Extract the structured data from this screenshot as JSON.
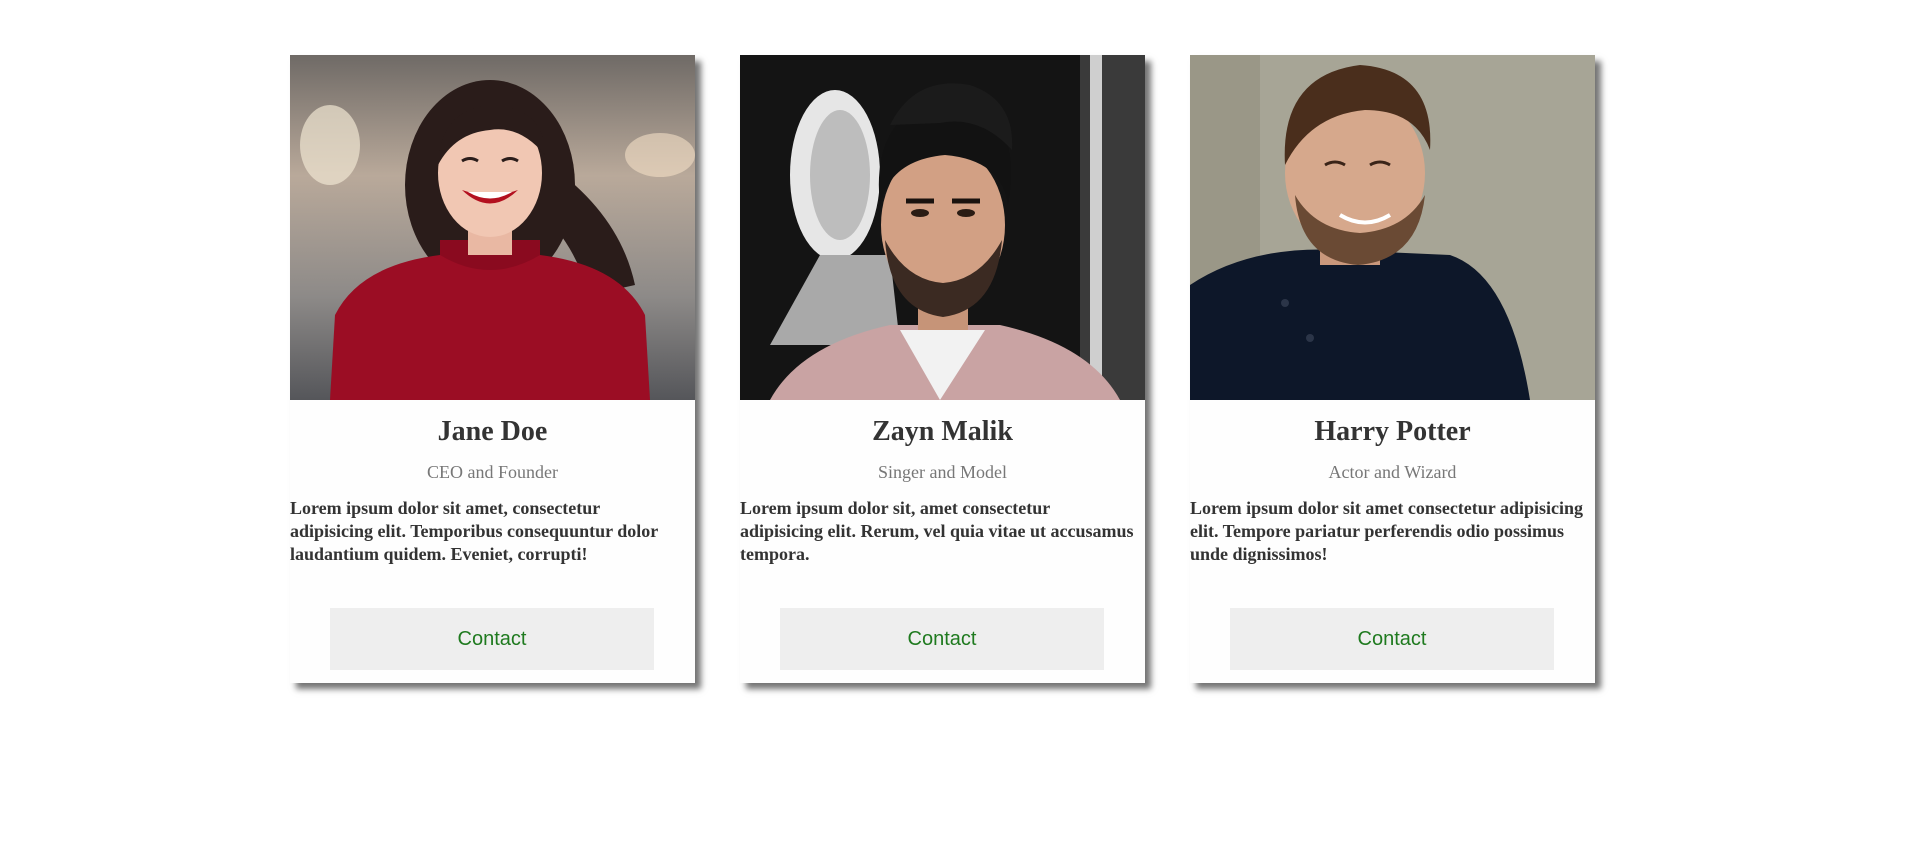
{
  "team": {
    "members": [
      {
        "name": "Jane Doe",
        "role": "CEO and Founder",
        "bio": "Lorem ipsum dolor sit amet, consectetur adipisicing elit. Temporibus consequuntur dolor laudantium quidem. Eveniet, corrupti!",
        "contact_label": "Contact",
        "photo_alt": "Jane Doe portrait"
      },
      {
        "name": "Zayn Malik",
        "role": "Singer and Model",
        "bio": "Lorem ipsum dolor sit, amet consectetur adipisicing elit. Rerum, vel quia vitae ut accusamus tempora.",
        "contact_label": "Contact",
        "photo_alt": "Zayn Malik portrait"
      },
      {
        "name": "Harry Potter",
        "role": "Actor and Wizard",
        "bio": "Lorem ipsum dolor sit amet consectetur adipisicing elit. Tempore pariatur perferendis odio possimus unde dignissimos!",
        "contact_label": "Contact",
        "photo_alt": "Harry Potter portrait"
      }
    ]
  },
  "colors": {
    "heading": "#333333",
    "subtitle": "#777777",
    "button_bg": "#eeeeee",
    "button_text": "#1f7a1f"
  }
}
